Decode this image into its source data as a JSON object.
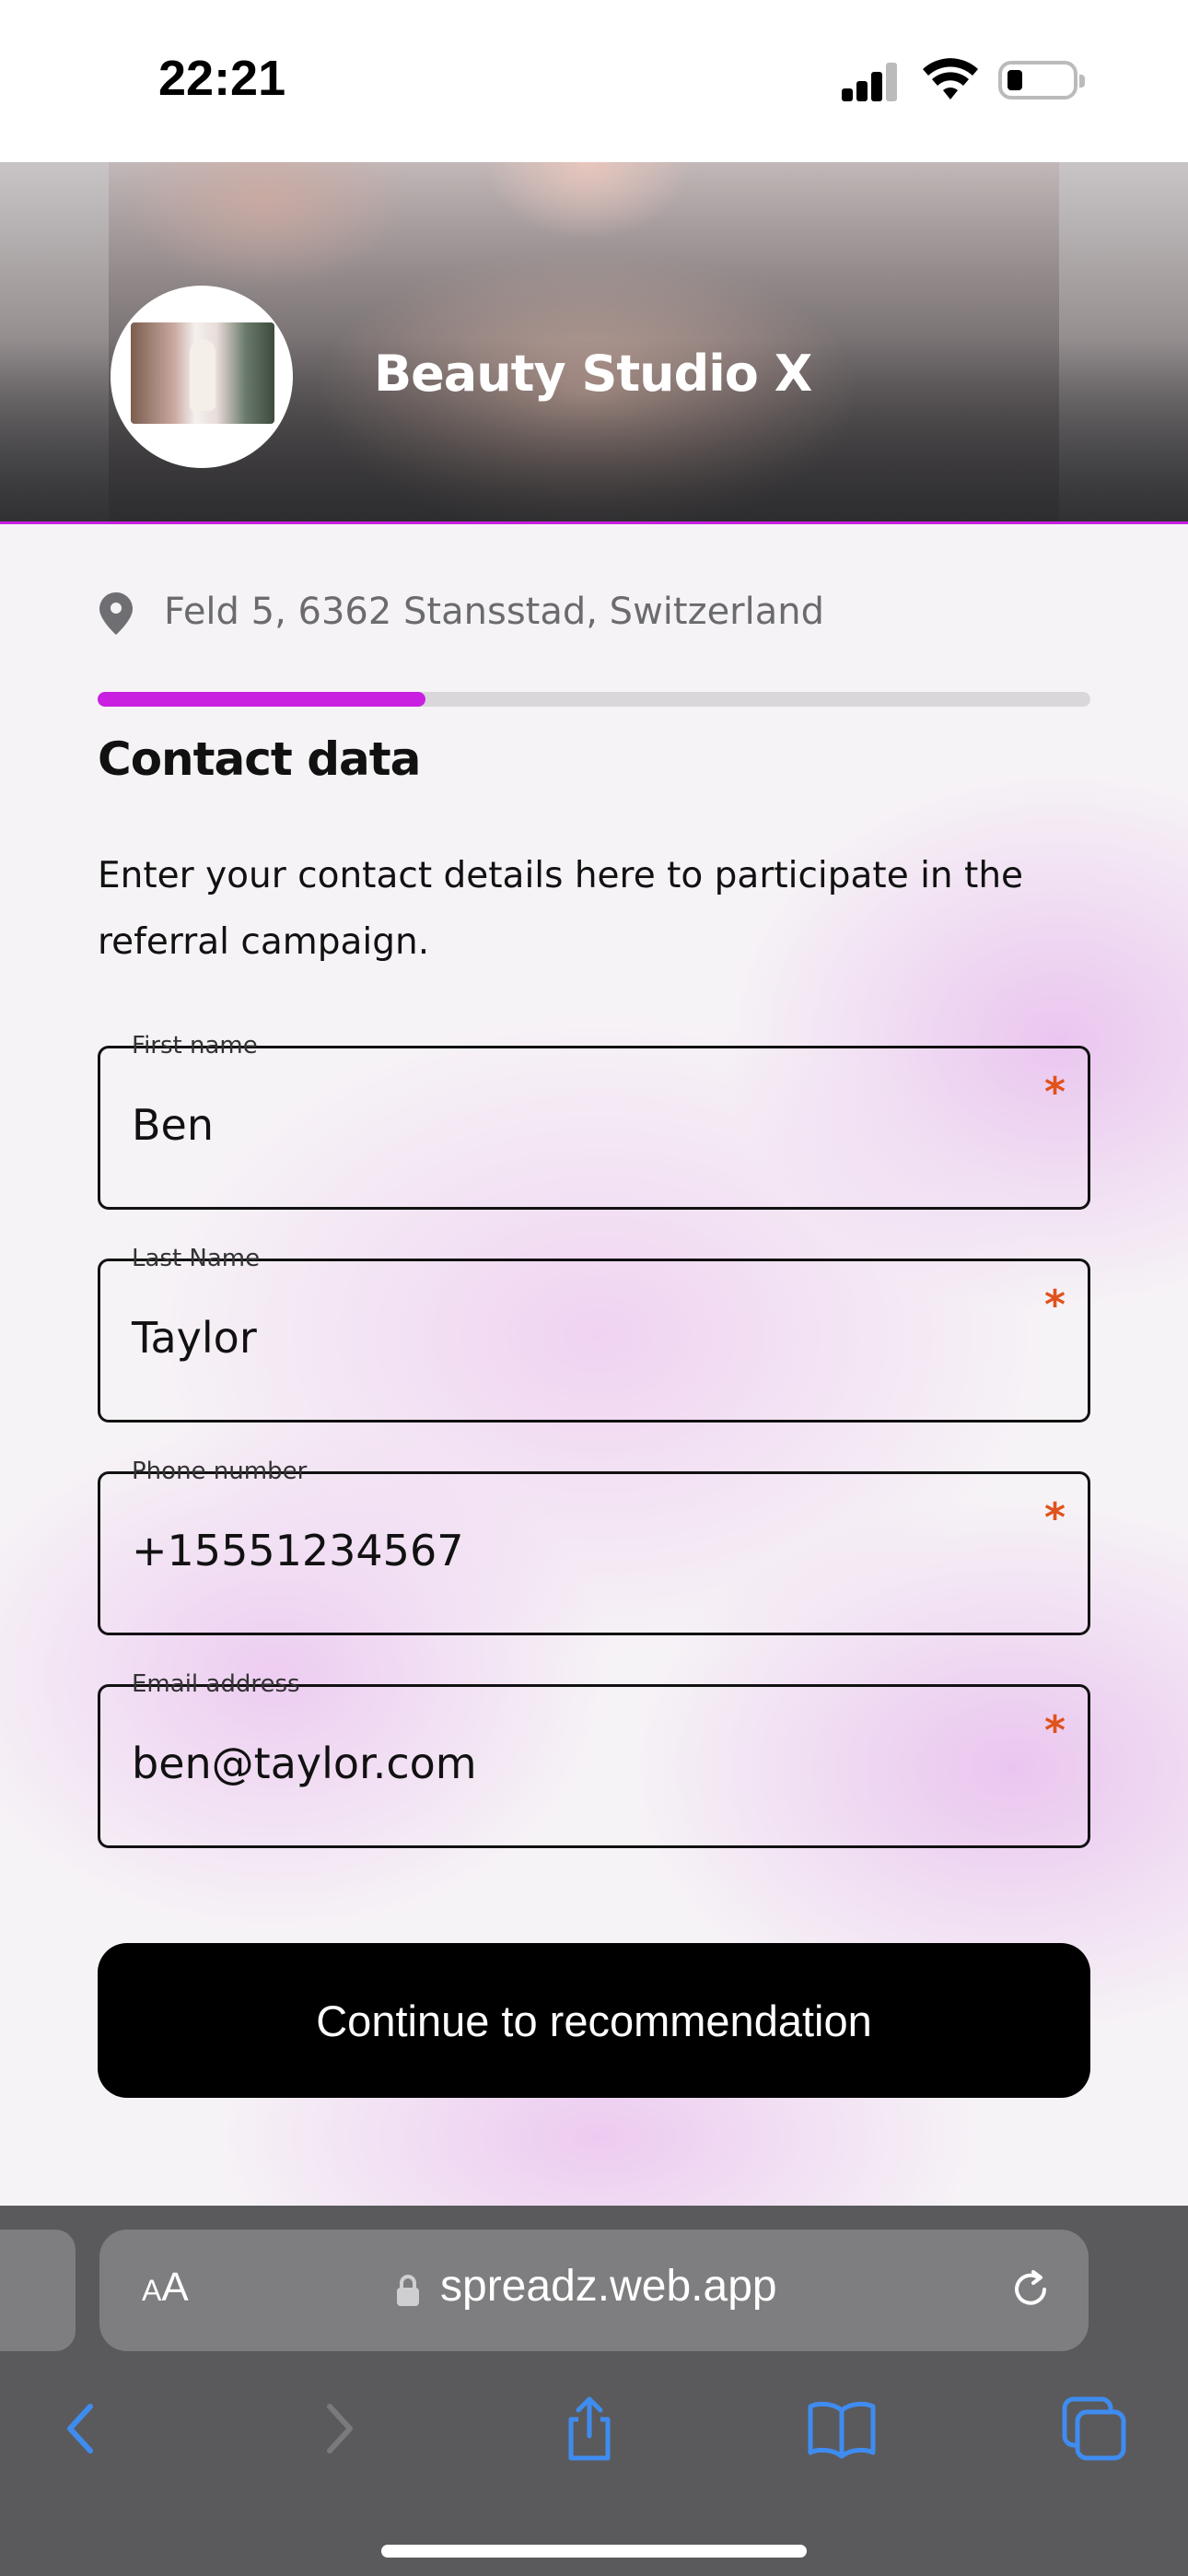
{
  "status_bar": {
    "time": "22:21"
  },
  "header": {
    "studio_name": "Beauty Studio X"
  },
  "location": {
    "address": "Feld 5, 6362 Stansstad, Switzerland"
  },
  "progress": {
    "fraction": 0.33
  },
  "form": {
    "title": "Contact data",
    "description": "Enter your contact details here to participate in the referral campaign.",
    "fields": [
      {
        "label": "First name",
        "value": "Ben",
        "required_mark": "*"
      },
      {
        "label": "Last Name",
        "value": "Taylor",
        "required_mark": "*"
      },
      {
        "label": "Phone number",
        "value": "+15551234567",
        "required_mark": "*"
      },
      {
        "label": "Email address",
        "value": "ben@taylor.com",
        "required_mark": "*"
      }
    ],
    "submit_label": "Continue to recommendation"
  },
  "browser": {
    "text_size_a": "A",
    "text_size_b": "A",
    "url": "spreadz.web.app",
    "icons": [
      "back-icon",
      "forward-icon",
      "share-icon",
      "bookmarks-icon",
      "tabs-icon",
      "reload-icon",
      "lock-icon"
    ]
  },
  "colors": {
    "accent": "#c81fe0",
    "required": "#e0521c",
    "button": "#000000"
  }
}
